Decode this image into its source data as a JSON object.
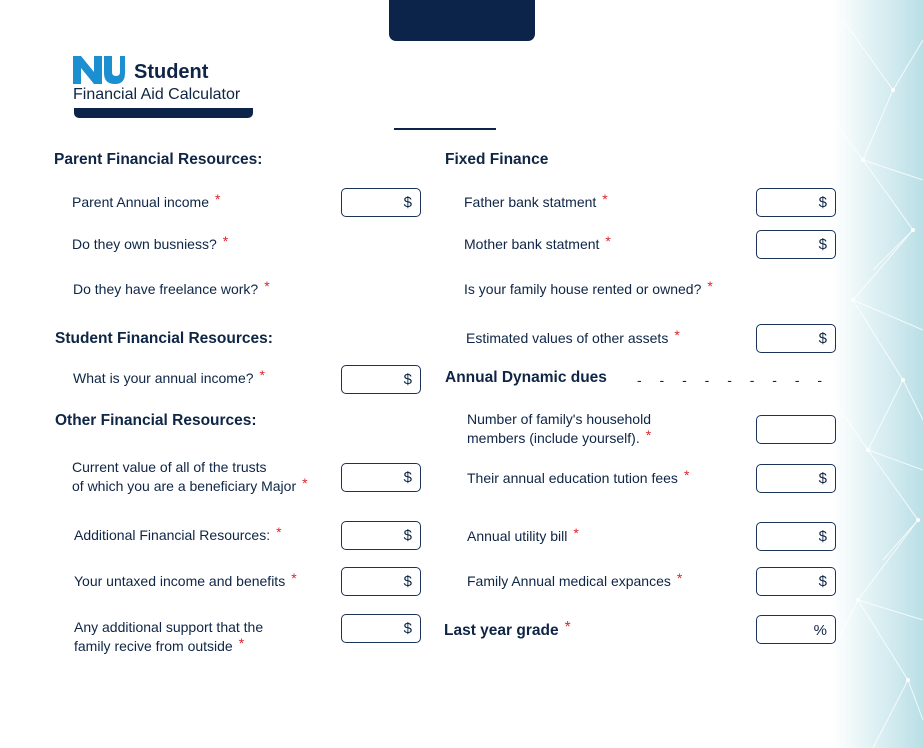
{
  "brand": {
    "logo_name": "nu-logo-icon",
    "title": "Student",
    "subtitle": "Financial Aid Calculator",
    "colors": {
      "navy": "#0c2449",
      "required": "#e0232b"
    }
  },
  "sections": {
    "parent": "Parent Financial Resources:",
    "student": "Student Financial Resources:",
    "other": "Other Financial Resources:",
    "fixed": "Fixed Finance",
    "dynamic": "Annual Dynamic dues",
    "dynamic_dashes": "- - - - - - - - -",
    "last_grade": "Last year grade"
  },
  "required_mark": "*",
  "left": {
    "parent_income": {
      "label": "Parent Annual income",
      "unit": "$"
    },
    "own_business": {
      "label": "Do they own busniess?"
    },
    "freelance": {
      "label": "Do they have freelance work?"
    },
    "annual_income": {
      "label": "What is your annual income?",
      "unit": "$"
    },
    "trusts": {
      "line1": "Current value of all of the trusts",
      "line2": "of which you are a beneficiary Major",
      "unit": "$"
    },
    "additional": {
      "label": "Additional Financial Resources:",
      "unit": "$"
    },
    "untaxed": {
      "label": "Your untaxed income and benefits",
      "unit": "$"
    },
    "support": {
      "line1": "Any additional support that the",
      "line2": "family recive from outside",
      "unit": "$"
    }
  },
  "right": {
    "father_bank": {
      "label": "Father bank statment",
      "unit": "$"
    },
    "mother_bank": {
      "label": "Mother bank statment",
      "unit": "$"
    },
    "house": {
      "label": "Is your family house rented or owned?"
    },
    "other_assets": {
      "label": "Estimated values of other assets",
      "unit": "$"
    },
    "household": {
      "line1": "Number of family's household",
      "line2": "members (include yourself)."
    },
    "tuition": {
      "label": "Their annual education tution fees",
      "unit": "$"
    },
    "utility": {
      "label": "Annual utility bill",
      "unit": "$"
    },
    "medical": {
      "label": "Family Annual medical expances",
      "unit": "$"
    },
    "grade": {
      "unit": "%"
    }
  }
}
